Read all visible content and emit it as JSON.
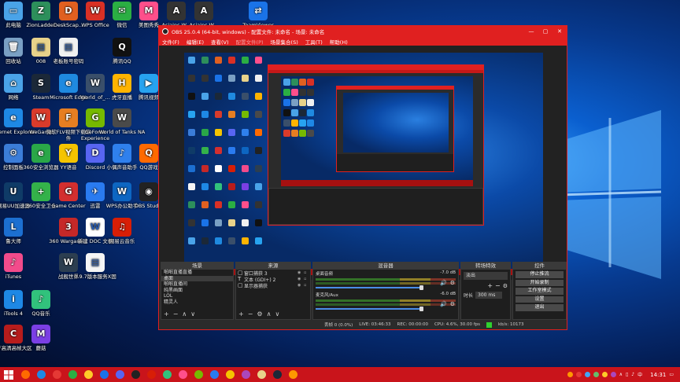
{
  "desktop": {
    "icons": [
      {
        "label": "此电脑",
        "glyph": "▭",
        "color": "#4aa3e8"
      },
      {
        "label": "ZionLadder",
        "glyph": "Z",
        "color": "#2d8f5b"
      },
      {
        "label": "DeskScap...",
        "glyph": "D",
        "color": "#e06020"
      },
      {
        "label": "WPS Office",
        "glyph": "W",
        "color": "#d93025"
      },
      {
        "label": "微信",
        "glyph": "✉",
        "color": "#2bae43"
      },
      {
        "label": "美图秀秀",
        "glyph": "M",
        "color": "#ff4f8b"
      },
      {
        "label": "Asiains W...",
        "glyph": "A",
        "color": "#333333"
      },
      {
        "label": "Asiains W...",
        "glyph": "A",
        "color": "#333333"
      },
      {
        "label": "TeamViewer",
        "glyph": "⇄",
        "color": "#1a73e8"
      },
      {
        "label": "回收站",
        "glyph": "🗑",
        "color": "#7aa0c4"
      },
      {
        "label": "008",
        "glyph": "▤",
        "color": "#e8d28a"
      },
      {
        "label": "老板账号密码",
        "glyph": "▤",
        "color": "#f0f0f0"
      },
      {
        "label": "腾讯QQ",
        "glyph": "Q",
        "color": "#111111"
      },
      {
        "label": "网络",
        "glyph": "⌂",
        "color": "#4aa3e8"
      },
      {
        "label": "Steam",
        "glyph": "S",
        "color": "#1b2838"
      },
      {
        "label": "Microsoft Edge",
        "glyph": "e",
        "color": "#1f8ae0"
      },
      {
        "label": "World_of_...",
        "glyph": "W",
        "color": "#3a4f6a"
      },
      {
        "label": "虎牙直播",
        "glyph": "H",
        "color": "#ffb400"
      },
      {
        "label": "腾讯视频",
        "glyph": "▶",
        "color": "#27a3f0"
      },
      {
        "label": "Internet Explorer",
        "glyph": "e",
        "color": "#1e88e5"
      },
      {
        "label": "WeGame",
        "glyph": "W",
        "color": "#d93b2b"
      },
      {
        "label": "微软FLV视频下载软件",
        "glyph": "F",
        "color": "#e67e22"
      },
      {
        "label": "GeForce Experience",
        "glyph": "G",
        "color": "#76b900"
      },
      {
        "label": "World of Tanks NA",
        "glyph": "W",
        "color": "#4a4a4a"
      },
      {
        "label": "控制面板",
        "glyph": "⚙",
        "color": "#3b7dd8"
      },
      {
        "label": "360安全浏览器",
        "glyph": "e",
        "color": "#2aa748"
      },
      {
        "label": "YY语音",
        "glyph": "Y",
        "color": "#f5c400"
      },
      {
        "label": "Discord",
        "glyph": "D",
        "color": "#5865f2"
      },
      {
        "label": "小偶声音助手",
        "glyph": "♪",
        "color": "#2f80ed"
      },
      {
        "label": "QQ游戏",
        "glyph": "Q",
        "color": "#ff6a00"
      },
      {
        "label": "网易UU加速器",
        "glyph": "U",
        "color": "#0f3b67"
      },
      {
        "label": "360安全卫士",
        "glyph": "+",
        "color": "#34b24a"
      },
      {
        "label": "Game Center",
        "glyph": "G",
        "color": "#d32f2f"
      },
      {
        "label": "迅雷",
        "glyph": "✈",
        "color": "#2a7bf0"
      },
      {
        "label": "WPS办公助手",
        "glyph": "W",
        "color": "#0d66c2"
      },
      {
        "label": "OBS Studio",
        "glyph": "◉",
        "color": "#222222"
      },
      {
        "label": "鲁大师",
        "glyph": "L",
        "color": "#1c6fd1"
      },
      {
        "label": "360 Wargami...",
        "glyph": "3",
        "color": "#c62828"
      },
      {
        "label": "新建 DOC 文档",
        "glyph": "W",
        "color": "#ffffff"
      },
      {
        "label": "网易云音乐",
        "glyph": "♫",
        "color": "#d81e06"
      },
      {
        "label": "iTunes",
        "glyph": "♪",
        "color": "#f24b8b"
      },
      {
        "label": "战舰世界",
        "glyph": "W",
        "color": "#2c3e50"
      },
      {
        "label": "0.9.7版本服务X固",
        "glyph": "▤",
        "color": "#f5f5f5"
      },
      {
        "label": "iTools 4",
        "glyph": "i",
        "color": "#1e88e5"
      },
      {
        "label": "QQ音乐",
        "glyph": "♪",
        "color": "#31c27c"
      },
      {
        "label": "CF高清高帧大区",
        "glyph": "C",
        "color": "#b71c1c"
      },
      {
        "label": "蘑菇",
        "glyph": "M",
        "color": "#7b3fe4"
      }
    ]
  },
  "obs": {
    "title": "OBS 25.0.4 (64-bit, windows) - 配置文件: 未命名 - 场景: 未命名",
    "window_buttons": [
      "—",
      "▢",
      "✕"
    ],
    "menu": [
      "文件(F)",
      "编辑(E)",
      "查看(V)",
      "配置文件(P)",
      "场景集合(S)",
      "工具(T)",
      "帮助(H)"
    ],
    "docks": {
      "scenes": {
        "header": "场景",
        "items": [
          "啪啪直播直播",
          "桌面",
          "啪啪直播间",
          "纯黑画面",
          "LOL",
          "精灵人"
        ]
      },
      "sources": {
        "header": "来源",
        "items": [
          {
            "type": "▢",
            "name": "窗口捕获 3"
          },
          {
            "type": "T",
            "name": "文本 (GDI+) 2"
          },
          {
            "type": "▢",
            "name": "显示器捕获"
          }
        ]
      },
      "mixer": {
        "header": "混音器",
        "channels": [
          {
            "name": "桌面音频",
            "db": "-7.0 dB"
          },
          {
            "name": "麦克风/Aux",
            "db": "-6.0 dB"
          }
        ]
      },
      "transitions": {
        "header": "转场特效",
        "selected": "淡出",
        "duration_label": "时长",
        "duration_value": "300 ms"
      },
      "controls": {
        "header": "控件",
        "buttons": [
          "停止推流",
          "开始录制",
          "工作室模式",
          "设置",
          "退出"
        ]
      }
    },
    "status": {
      "dropped": "丢帧 0 (0.0%)",
      "live": "LIVE: 03:46:33",
      "rec": "REC: 00:00:00",
      "cpu": "CPU: 4.6%, 30.00 fps",
      "bitrate": "kb/s: 10173"
    }
  },
  "taskbar": {
    "clock": "14:31",
    "lang": "中"
  },
  "colors": {
    "accent": "#e02020",
    "taskbar": "#c9141b"
  }
}
